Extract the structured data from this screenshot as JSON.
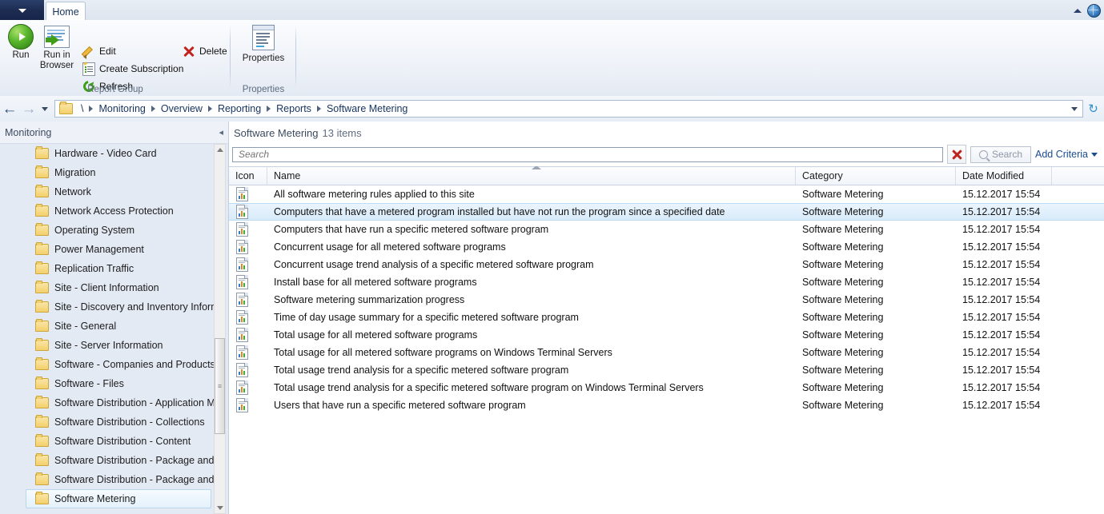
{
  "window": {
    "app_menu_icon": "chevron-down-icon",
    "tab_label": "Home",
    "collapse_ribbon_icon": "chevron-up-icon",
    "help_icon": "globe-help-icon"
  },
  "ribbon": {
    "groups": [
      {
        "label": "Report Group"
      },
      {
        "label": "Properties"
      }
    ],
    "buttons": {
      "run": "Run",
      "run_in_browser_line1": "Run in",
      "run_in_browser_line2": "Browser",
      "edit": "Edit",
      "create_subscription": "Create Subscription",
      "refresh": "Refresh",
      "delete": "Delete",
      "properties": "Properties"
    }
  },
  "navbar": {
    "back_icon": "arrow-left-icon",
    "forward_icon": "arrow-right-icon",
    "history_icon": "chevron-down-icon",
    "root": "\\",
    "crumbs": [
      "Monitoring",
      "Overview",
      "Reporting",
      "Reports",
      "Software Metering"
    ],
    "dropdown_icon": "chevron-down-icon",
    "refresh_icon": "refresh-icon"
  },
  "sidebar": {
    "title": "Monitoring",
    "collapse_icon": "chevron-left-icon",
    "items": [
      {
        "label": "Hardware - Video Card",
        "selected": false
      },
      {
        "label": "Migration",
        "selected": false
      },
      {
        "label": "Network",
        "selected": false
      },
      {
        "label": "Network Access Protection",
        "selected": false
      },
      {
        "label": "Operating System",
        "selected": false
      },
      {
        "label": "Power Management",
        "selected": false
      },
      {
        "label": "Replication Traffic",
        "selected": false
      },
      {
        "label": "Site - Client Information",
        "selected": false
      },
      {
        "label": "Site - Discovery and Inventory Inform",
        "selected": false
      },
      {
        "label": "Site - General",
        "selected": false
      },
      {
        "label": "Site - Server Information",
        "selected": false
      },
      {
        "label": "Software - Companies and Products",
        "selected": false
      },
      {
        "label": "Software - Files",
        "selected": false
      },
      {
        "label": "Software Distribution - Application M",
        "selected": false
      },
      {
        "label": "Software Distribution - Collections",
        "selected": false
      },
      {
        "label": "Software Distribution - Content",
        "selected": false
      },
      {
        "label": "Software Distribution - Package and I",
        "selected": false
      },
      {
        "label": "Software Distribution - Package and I",
        "selected": false
      },
      {
        "label": "Software Metering",
        "selected": true
      }
    ]
  },
  "main": {
    "title": "Software Metering",
    "item_count": "13 items",
    "search": {
      "placeholder": "Search",
      "value": "",
      "clear_icon": "red-x-clear-icon",
      "search_button_label": "Search",
      "search_icon": "magnifier-icon",
      "add_criteria_label": "Add Criteria",
      "add_criteria_icon": "chevron-down-icon"
    },
    "table": {
      "columns": [
        "Icon",
        "Name",
        "Category",
        "Date Modified"
      ],
      "sorted_column": "Name",
      "sort_direction": "ascending",
      "rows": [
        {
          "icon": "report-icon",
          "name": "All software metering rules applied to this site",
          "category": "Software Metering",
          "date": "15.12.2017 15:54",
          "selected": false
        },
        {
          "icon": "report-icon",
          "name": "Computers that have a metered program installed but have not run the program since a specified date",
          "category": "Software Metering",
          "date": "15.12.2017 15:54",
          "selected": true
        },
        {
          "icon": "report-icon",
          "name": "Computers that have run a specific metered software program",
          "category": "Software Metering",
          "date": "15.12.2017 15:54",
          "selected": false
        },
        {
          "icon": "report-icon",
          "name": "Concurrent usage for all metered software programs",
          "category": "Software Metering",
          "date": "15.12.2017 15:54",
          "selected": false
        },
        {
          "icon": "report-icon",
          "name": "Concurrent usage trend analysis of a specific metered software program",
          "category": "Software Metering",
          "date": "15.12.2017 15:54",
          "selected": false
        },
        {
          "icon": "report-icon",
          "name": "Install base for all metered software programs",
          "category": "Software Metering",
          "date": "15.12.2017 15:54",
          "selected": false
        },
        {
          "icon": "report-icon",
          "name": "Software metering summarization progress",
          "category": "Software Metering",
          "date": "15.12.2017 15:54",
          "selected": false
        },
        {
          "icon": "report-icon",
          "name": "Time of day usage summary for a specific metered software program",
          "category": "Software Metering",
          "date": "15.12.2017 15:54",
          "selected": false
        },
        {
          "icon": "report-icon",
          "name": "Total usage for all metered software programs",
          "category": "Software Metering",
          "date": "15.12.2017 15:54",
          "selected": false
        },
        {
          "icon": "report-icon",
          "name": "Total usage for all metered software programs on Windows Terminal Servers",
          "category": "Software Metering",
          "date": "15.12.2017 15:54",
          "selected": false
        },
        {
          "icon": "report-icon",
          "name": "Total usage trend analysis for a specific metered software program",
          "category": "Software Metering",
          "date": "15.12.2017 15:54",
          "selected": false
        },
        {
          "icon": "report-icon",
          "name": "Total usage trend analysis for a specific metered software program on Windows Terminal Servers",
          "category": "Software Metering",
          "date": "15.12.2017 15:54",
          "selected": false
        },
        {
          "icon": "report-icon",
          "name": "Users that have run a specific metered software program",
          "category": "Software Metering",
          "date": "15.12.2017 15:54",
          "selected": false
        }
      ]
    }
  },
  "colors": {
    "accent": "#1a4d8f",
    "selection": "#d8ebfa",
    "folder": "#f3cf6c",
    "run_green": "#57b52c",
    "delete_red": "#c0241f"
  }
}
